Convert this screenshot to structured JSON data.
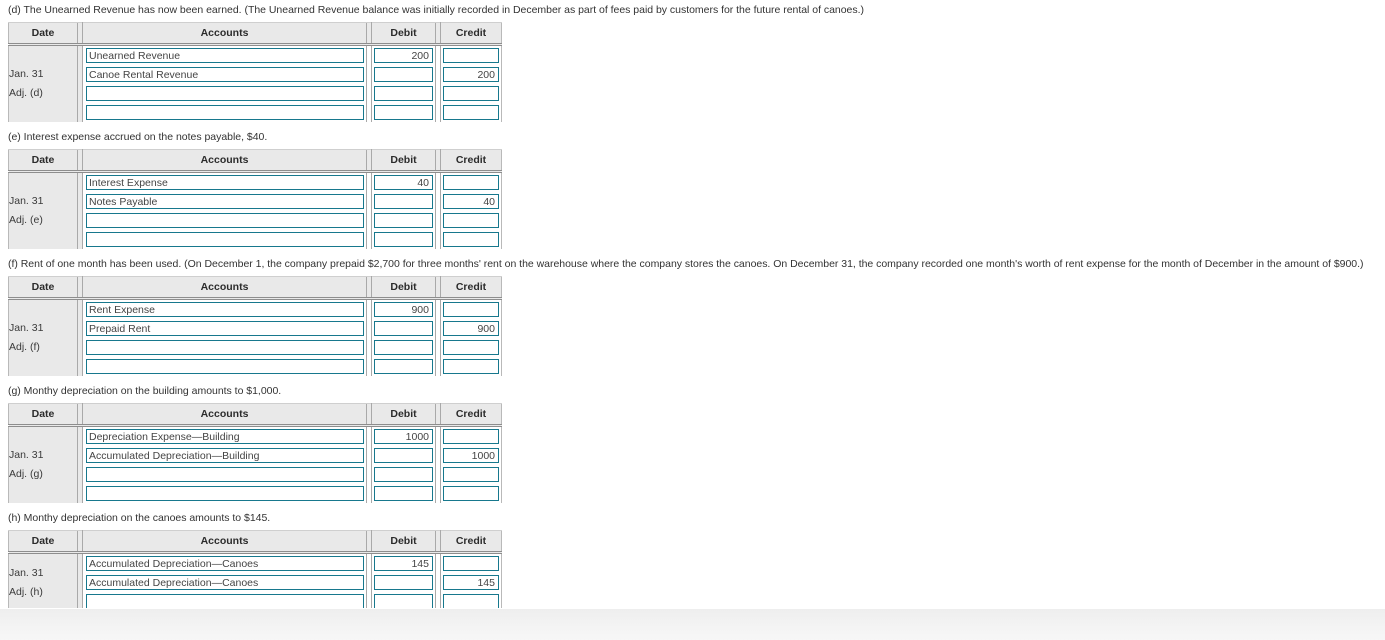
{
  "table_headers": {
    "date": "Date",
    "accounts": "Accounts",
    "debit": "Debit",
    "credit": "Credit"
  },
  "colors": {
    "field_border": "#17788d",
    "header_bg": "#e9e9e9",
    "text": "#333333"
  },
  "sections": [
    {
      "id": "d",
      "prompt": "(d) The Unearned Revenue has now been earned. (The Unearned Revenue balance was initially recorded in December as part of fees paid by customers for the future rental of canoes.)",
      "date_lines": [
        "Jan. 31",
        "Adj. (d)"
      ],
      "rows": [
        {
          "account": "Unearned Revenue",
          "debit": "200",
          "credit": ""
        },
        {
          "account": "Canoe Rental Revenue",
          "debit": "",
          "credit": "200"
        },
        {
          "account": "",
          "debit": "",
          "credit": ""
        },
        {
          "account": "",
          "debit": "",
          "credit": ""
        }
      ]
    },
    {
      "id": "e",
      "prompt": "(e) Interest expense accrued on the notes payable, $40.",
      "date_lines": [
        "Jan. 31",
        "Adj. (e)"
      ],
      "rows": [
        {
          "account": "Interest Expense",
          "debit": "40",
          "credit": ""
        },
        {
          "account": "Notes Payable",
          "debit": "",
          "credit": "40"
        },
        {
          "account": "",
          "debit": "",
          "credit": ""
        },
        {
          "account": "",
          "debit": "",
          "credit": ""
        }
      ]
    },
    {
      "id": "f",
      "prompt": "(f) Rent of one month has been used. (On December 1, the company prepaid $2,700 for three months' rent on the warehouse where the company stores the canoes. On December 31, the company recorded one month's worth of rent expense for the month of December in the amount of $900.)",
      "date_lines": [
        "Jan. 31",
        "Adj. (f)"
      ],
      "rows": [
        {
          "account": "Rent Expense",
          "debit": "900",
          "credit": ""
        },
        {
          "account": "Prepaid Rent",
          "debit": "",
          "credit": "900"
        },
        {
          "account": "",
          "debit": "",
          "credit": ""
        },
        {
          "account": "",
          "debit": "",
          "credit": ""
        }
      ]
    },
    {
      "id": "g",
      "prompt": "(g) Monthy depreciation on the building amounts to $1,000.",
      "date_lines": [
        "Jan. 31",
        "Adj. (g)"
      ],
      "rows": [
        {
          "account": "Depreciation Expense—Building",
          "debit": "1000",
          "credit": ""
        },
        {
          "account": "Accumulated Depreciation—Building",
          "debit": "",
          "credit": "1000"
        },
        {
          "account": "",
          "debit": "",
          "credit": ""
        },
        {
          "account": "",
          "debit": "",
          "credit": ""
        }
      ]
    },
    {
      "id": "h",
      "prompt": "(h) Monthy depreciation on the canoes amounts to $145.",
      "date_lines": [
        "Jan. 31",
        "Adj. (h)"
      ],
      "rows": [
        {
          "account": "Accumulated Depreciation—Canoes",
          "debit": "145",
          "credit": ""
        },
        {
          "account": "Accumulated Depreciation—Canoes",
          "debit": "",
          "credit": "145"
        },
        {
          "account": "",
          "debit": "",
          "credit": ""
        }
      ]
    }
  ]
}
